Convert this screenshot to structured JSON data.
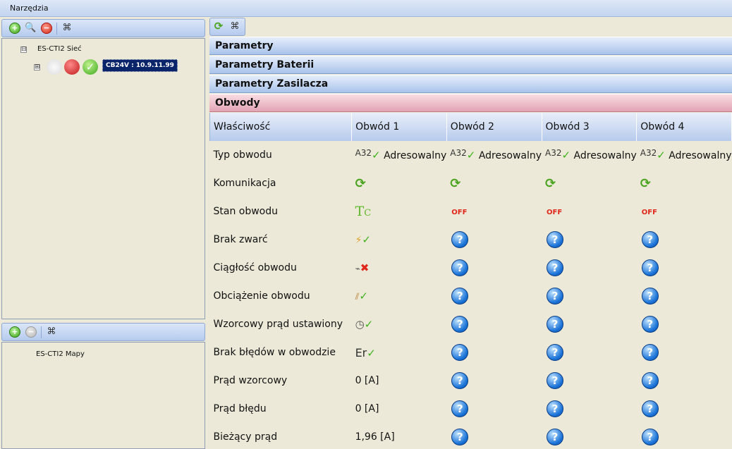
{
  "menu": {
    "title": "Narzędzia"
  },
  "tree": {
    "root_label": "ES-CTI2 Sieć",
    "node_label": "CB24V : 10.9.11.99",
    "expander_minus": "⊟",
    "expander_plus": "⊞"
  },
  "maps": {
    "root_label": "ES-CTI2 Mapy"
  },
  "sections": {
    "s1": "Parametry",
    "s2": "Parametry Baterii",
    "s3": "Parametry Zasilacza",
    "s4": "Obwody"
  },
  "columns": {
    "prop": "Właściwość",
    "c1": "Obwód 1",
    "c2": "Obwód 2",
    "c3": "Obwód 3",
    "c4": "Obwód 4"
  },
  "rows": {
    "r1": {
      "label": "Typ obwodu",
      "val": "Adresowalny",
      "icon_text": "A32"
    },
    "r2": {
      "label": "Komunikacja"
    },
    "r3": {
      "label": "Stan obwodu",
      "tc": "T",
      "tc_sub": "C",
      "off": "OFF"
    },
    "r4": {
      "label": "Brak zwarć"
    },
    "r5": {
      "label": "Ciągłość obwodu"
    },
    "r6": {
      "label": "Obciążenie obwodu"
    },
    "r7": {
      "label": "Wzorcowy prąd ustawiony"
    },
    "r8": {
      "label": "Brak błędów w obwodzie",
      "icon_text": "Er"
    },
    "r9": {
      "label": "Prąd wzorcowy",
      "c1": "0 [A]"
    },
    "r10": {
      "label": "Prąd błędu",
      "c1": "0 [A]"
    },
    "r11": {
      "label": "Bieżący prąd",
      "c1": "1,96 [A]"
    }
  },
  "status_colors": {
    "ok": "#3fb21b",
    "off": "#e0271b",
    "unknown": "#1b74d8"
  },
  "icons": [
    "add-icon",
    "zoom-icon",
    "remove-icon",
    "binoculars-icon",
    "refresh-icon",
    "check-icon",
    "question-icon",
    "lightning-icon",
    "resistor-icon",
    "gauge-icon",
    "cross-icon"
  ]
}
